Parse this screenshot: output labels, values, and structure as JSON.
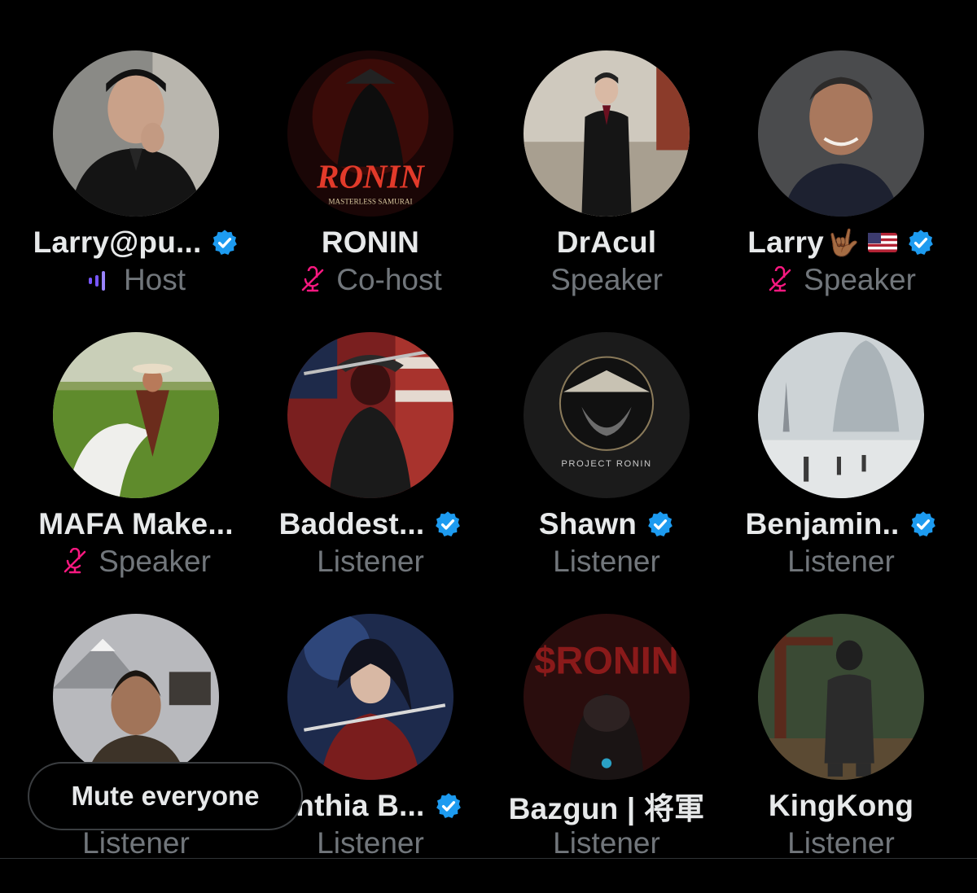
{
  "participants": [
    {
      "name": "Larry@pu...",
      "role": "Host",
      "verified": true,
      "role_icon": "speaking-bars-icon"
    },
    {
      "name": "RONIN",
      "role": "Co-host",
      "verified": false,
      "role_icon": "mic-muted-icon",
      "avatar_text": "RONIN",
      "avatar_subtext": "MASTERLESS SAMURAI"
    },
    {
      "name": "DrAcul",
      "role": "Speaker",
      "verified": false,
      "role_icon": ""
    },
    {
      "name": "Larry",
      "role": "Speaker",
      "verified": true,
      "role_icon": "mic-muted-icon",
      "emoji": "🤟🏾"
    },
    {
      "name": "MAFA Make...",
      "role": "Speaker",
      "verified": false,
      "role_icon": "mic-muted-icon"
    },
    {
      "name": "Baddest...",
      "role": "Listener",
      "verified": true,
      "role_icon": ""
    },
    {
      "name": "Shawn",
      "role": "Listener",
      "verified": true,
      "role_icon": "",
      "avatar_text": "PROJECT RONIN"
    },
    {
      "name": "Benjamin..",
      "role": "Listener",
      "verified": true,
      "role_icon": ""
    },
    {
      "name": "",
      "role": "Listener",
      "verified": false,
      "role_icon": ""
    },
    {
      "name": "ynthia B...",
      "role": "Listener",
      "verified": true,
      "role_icon": ""
    },
    {
      "name": "Bazgun | 将軍",
      "role": "Listener",
      "verified": false,
      "role_icon": "",
      "avatar_text": "$RONIN"
    },
    {
      "name": "KingKong",
      "role": "Listener",
      "verified": false,
      "role_icon": ""
    }
  ],
  "mute_button": {
    "label": "Mute everyone"
  },
  "colors": {
    "background": "#000000",
    "name": "#e7e9ea",
    "role": "#71767b",
    "verified": "#1d9bf0",
    "muted": "#f91880",
    "host_bars": "#7856ff"
  }
}
